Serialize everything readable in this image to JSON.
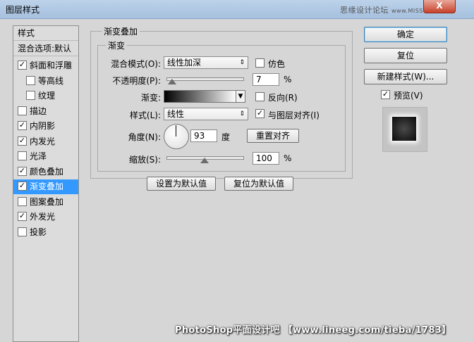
{
  "window": {
    "title": "图层样式",
    "close_glyph": "X",
    "watermark_top": "思缘设计论坛",
    "watermark_top_small": "www.MISSYUAN.com"
  },
  "sidebar": {
    "header_label": "样式",
    "blend_options_label": "混合选项:默认",
    "items": [
      {
        "label": "斜面和浮雕",
        "checked": true,
        "indent": false,
        "selected": false
      },
      {
        "label": "等高线",
        "checked": false,
        "indent": true,
        "selected": false
      },
      {
        "label": "纹理",
        "checked": false,
        "indent": true,
        "selected": false
      },
      {
        "label": "描边",
        "checked": false,
        "indent": false,
        "selected": false
      },
      {
        "label": "内阴影",
        "checked": true,
        "indent": false,
        "selected": false
      },
      {
        "label": "内发光",
        "checked": true,
        "indent": false,
        "selected": false
      },
      {
        "label": "光泽",
        "checked": false,
        "indent": false,
        "selected": false
      },
      {
        "label": "颜色叠加",
        "checked": true,
        "indent": false,
        "selected": false
      },
      {
        "label": "渐变叠加",
        "checked": true,
        "indent": false,
        "selected": true
      },
      {
        "label": "图案叠加",
        "checked": false,
        "indent": false,
        "selected": false
      },
      {
        "label": "外发光",
        "checked": true,
        "indent": false,
        "selected": false
      },
      {
        "label": "投影",
        "checked": false,
        "indent": false,
        "selected": false
      }
    ]
  },
  "panel": {
    "outer_title": "渐变叠加",
    "inner_title": "渐变",
    "blend_mode_label": "混合模式(O):",
    "blend_mode_value": "线性加深",
    "dither_label": "仿色",
    "dither_checked": false,
    "opacity_label": "不透明度(P):",
    "opacity_value": "7",
    "opacity_unit": "%",
    "opacity_fraction": 0.07,
    "gradient_label": "渐变:",
    "reverse_label": "反向(R)",
    "reverse_checked": false,
    "style_label": "样式(L):",
    "style_value": "线性",
    "align_label": "与图层对齐(I)",
    "align_checked": true,
    "angle_label": "角度(N):",
    "angle_value": "93",
    "angle_unit": "度",
    "reset_align_label": "重置对齐",
    "scale_label": "缩放(S):",
    "scale_value": "100",
    "scale_unit": "%",
    "scale_fraction": 0.5,
    "set_default_label": "设置为默认值",
    "reset_default_label": "复位为默认值"
  },
  "buttons": {
    "ok_label": "确定",
    "reset_label": "复位",
    "new_style_label": "新建样式(W)...",
    "preview_label": "预览(V)",
    "preview_checked": true
  },
  "watermark_bottom": "PhotoShop平面设计吧 【www.lineeg.com/tieba/1783】"
}
